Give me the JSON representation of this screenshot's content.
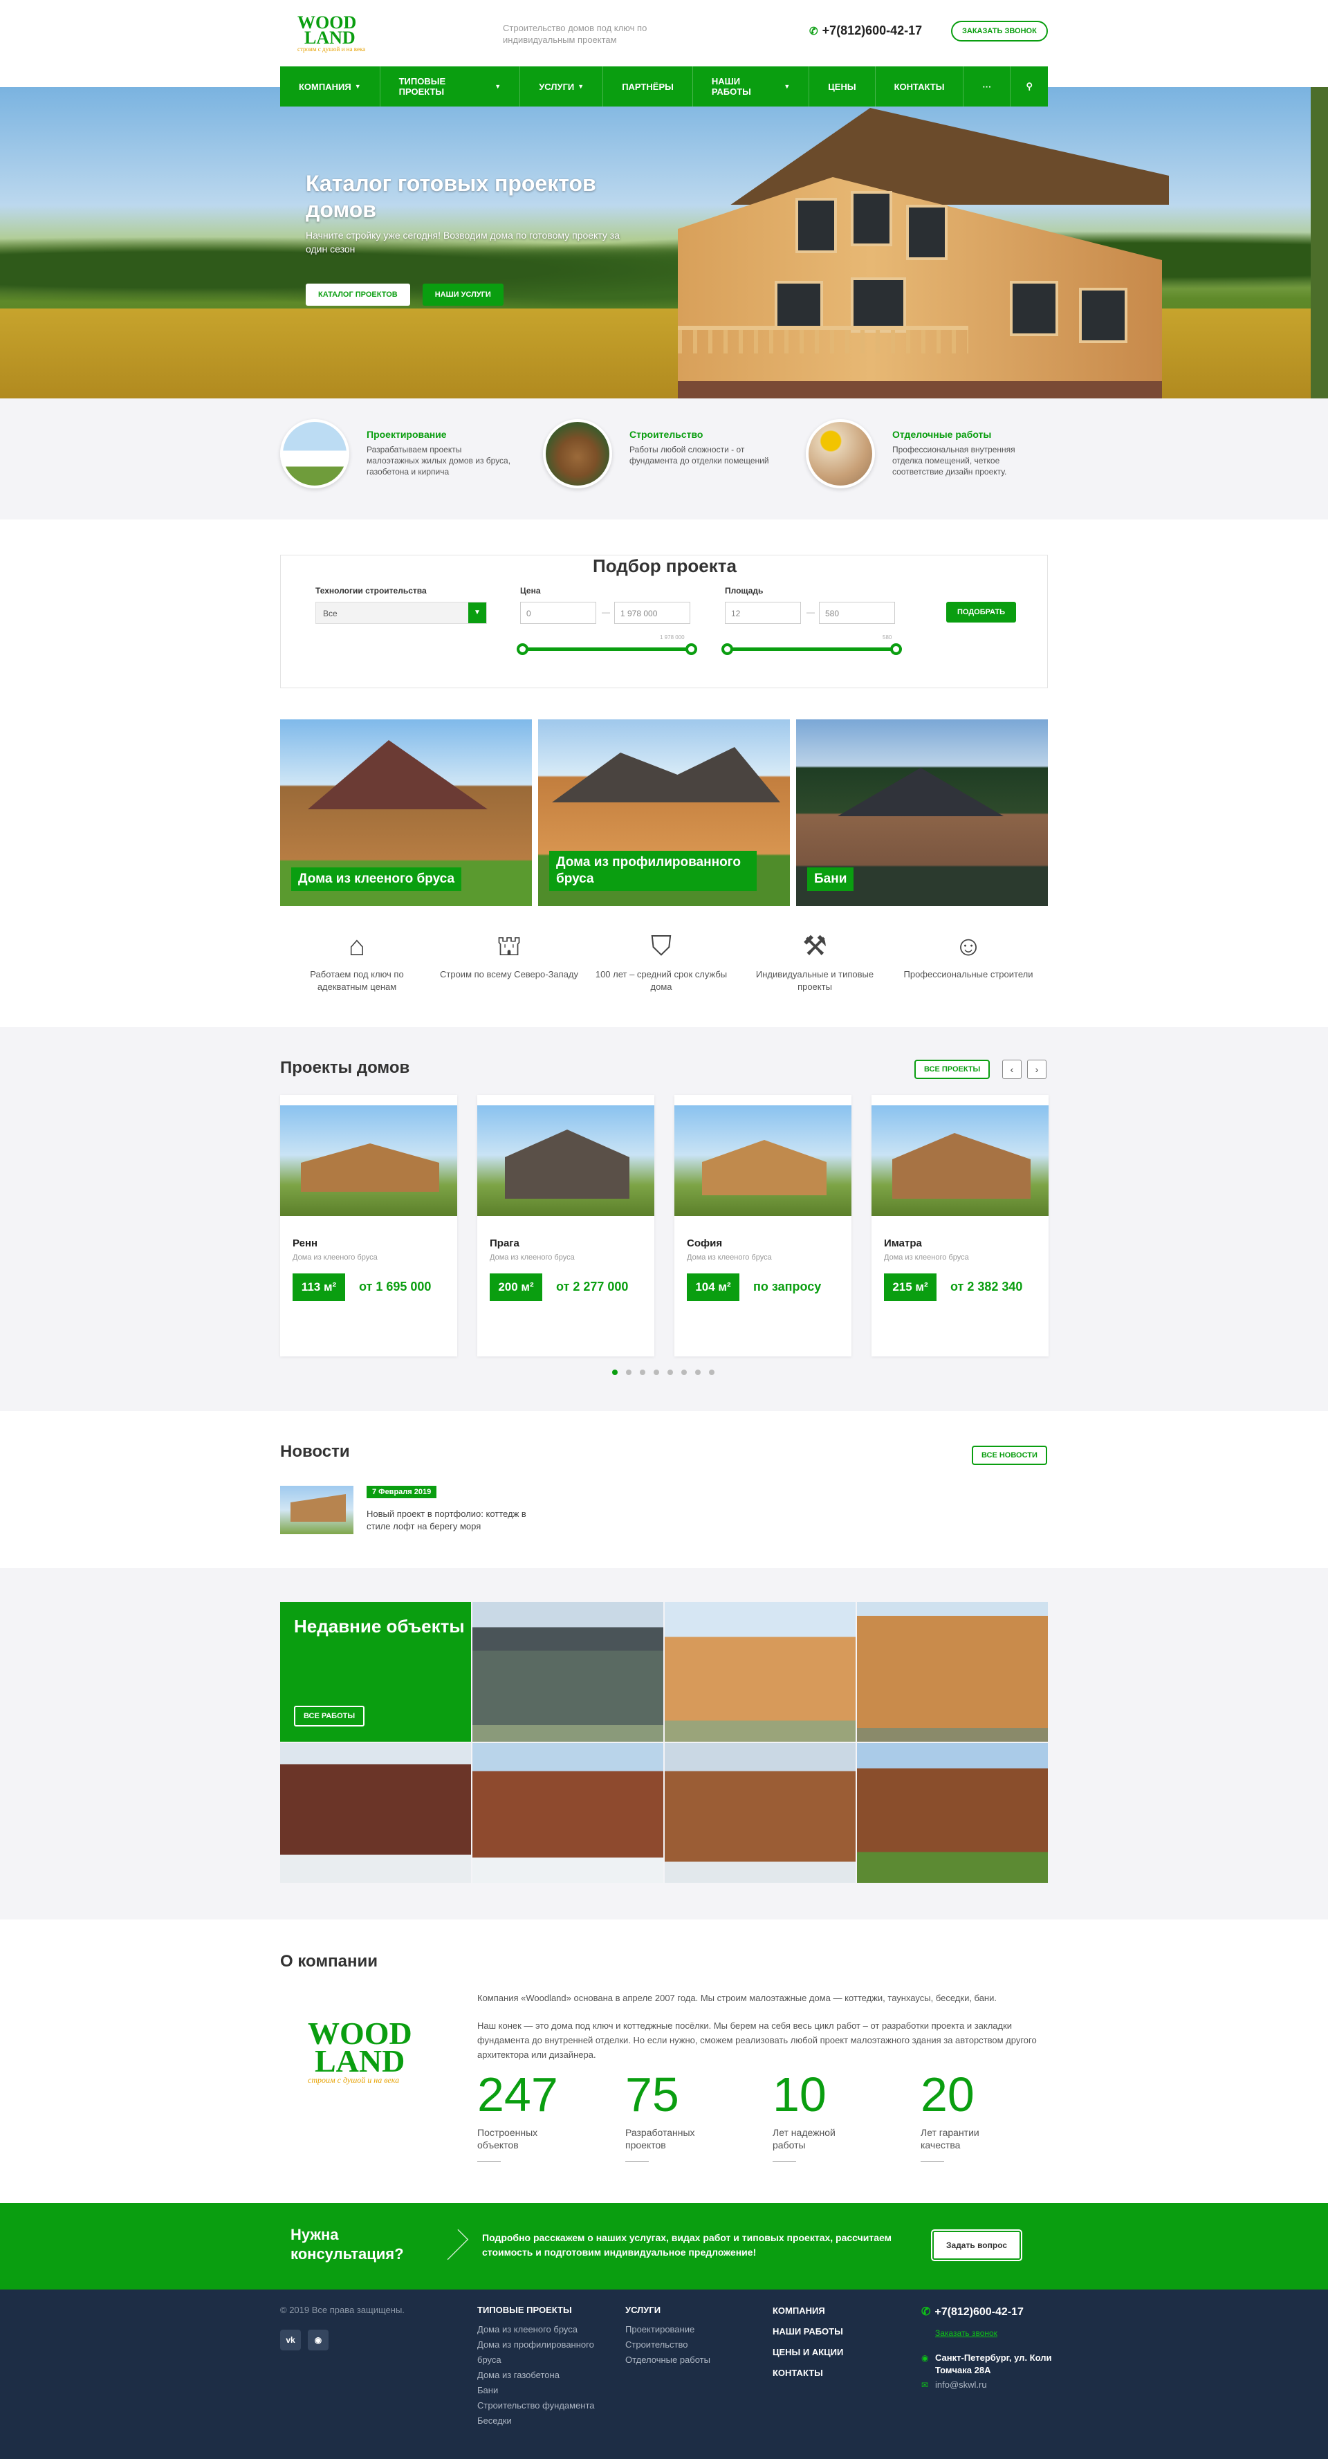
{
  "header": {
    "logo_top": "WOOD",
    "logo_bottom": "LAND",
    "logo_sub": "строим с душой и на века",
    "tagline": "Строительство домов под ключ по индивидуальным проектам",
    "phone": "+7(812)600-42-17",
    "call_button": "Заказать звонок"
  },
  "nav": {
    "items": [
      "Компания",
      "Типовые проекты",
      "Услуги",
      "Партнёры",
      "Наши работы",
      "Цены",
      "Контакты"
    ],
    "more": "···"
  },
  "hero": {
    "title": "Каталог готовых проектов домов",
    "subtitle": "Начните стройку уже сегодня! Возводим дома по готовому проекту за один сезон",
    "btn_catalog": "Каталог проектов",
    "btn_services": "Наши услуги"
  },
  "services": [
    {
      "title": "Проектирование",
      "text": "Разрабатываем проекты малоэтажных жилых домов из бруса, газобетона и кирпича"
    },
    {
      "title": "Строительство",
      "text": "Работы любой сложности - от фундамента до отделки помещений"
    },
    {
      "title": "Отделочные работы",
      "text": "Профессиональная внутренняя отделка помещений, четкое соответствие дизайн проекту."
    }
  ],
  "filter": {
    "title": "Подбор проекта",
    "tech_label": "Технологии строительства",
    "tech_value": "Все",
    "price_label": "Цена",
    "price_min": "0",
    "price_max": "1 978 000",
    "price_hint": "1 978 000",
    "area_label": "Площадь",
    "area_min": "12",
    "area_max": "580",
    "area_hint": "580",
    "submit": "Подобрать"
  },
  "categories": [
    {
      "label": "Дома из клееного бруса"
    },
    {
      "label": "Дома из профилированного бруса"
    },
    {
      "label": "Бани"
    }
  ],
  "features": [
    {
      "icon": "house-hand-icon",
      "text": "Работаем под ключ по адекватным ценам"
    },
    {
      "icon": "crane-icon",
      "text": "Строим по всему Северо-Западу"
    },
    {
      "icon": "shield-check-icon",
      "text": "100 лет – средний срок службы дома"
    },
    {
      "icon": "tools-icon",
      "text": "Индивидуальные и типовые проекты"
    },
    {
      "icon": "worker-icon",
      "text": "Профессиональные строители"
    }
  ],
  "projects": {
    "title": "Проекты домов",
    "all_button": "Все проекты",
    "items": [
      {
        "name": "Ренн",
        "type": "Дома из клееного бруса",
        "area": "113 м²",
        "price": "от 1 695 000"
      },
      {
        "name": "Прага",
        "type": "Дома из клееного бруса",
        "area": "200 м²",
        "price": "от 2 277 000"
      },
      {
        "name": "София",
        "type": "Дома из клееного бруса",
        "area": "104 м²",
        "price": "по запросу"
      },
      {
        "name": "Иматра",
        "type": "Дома из клееного бруса",
        "area": "215 м²",
        "price": "от 2 382 340"
      }
    ],
    "pages": 8,
    "active_page": 1
  },
  "news": {
    "title": "Новости",
    "all_button": "Все новости",
    "date": "7 Февраля 2019",
    "text": "Новый проект в портфолио: коттедж в стиле лофт на берегу моря"
  },
  "recent": {
    "title": "Недавние объекты",
    "button": "Все работы"
  },
  "about": {
    "title": "О компании",
    "p1": "Компания «Woodland» основана в апреле 2007 года. Мы строим малоэтажные дома — коттеджи, таунхаусы, беседки, бани.",
    "p2": "Наш конек — это дома под ключ и коттеджные посёлки. Мы берем на себя весь цикл работ – от разработки проекта и закладки фундамента до внутренней отделки. Но если нужно, сможем реализовать любой проект малоэтажного здания за авторством другого архитектора или дизайнера.",
    "stats": [
      {
        "num": "247",
        "text": "Построенных объектов"
      },
      {
        "num": "75",
        "text": "Разработанных проектов"
      },
      {
        "num": "10",
        "text": "Лет надежной работы"
      },
      {
        "num": "20",
        "text": "Лет гарантии качества"
      }
    ]
  },
  "consult": {
    "title": "Нужна консультация?",
    "text": "Подробно расскажем о наших услугах, видах работ и типовых проектах, рассчитаем стоимость и подготовим индивидуальное предложение!",
    "button": "Задать вопрос"
  },
  "footer": {
    "copyright": "© 2019 Все права защищены.",
    "vk": "vk",
    "col1_title": "Типовые проекты",
    "col1_links": [
      "Дома из клееного бруса",
      "Дома из профилированного бруса",
      "Дома из газобетона",
      "Бани",
      "Строительство фундамента",
      "Беседки"
    ],
    "col2_title": "Услуги",
    "col2_links": [
      "Проектирование",
      "Строительство",
      "Отделочные работы"
    ],
    "col3_links": [
      "Компания",
      "Наши работы",
      "Цены и акции",
      "Контакты"
    ],
    "phone": "+7(812)600-42-17",
    "call": "Заказать звонок",
    "address": "Санкт-Петербург, ул. Коли Томчака 28А",
    "email": "info@skwl.ru"
  },
  "colors": {
    "accent": "#0a9e10",
    "footer_bg": "#1d2d45",
    "section_bg": "#f4f4f7"
  }
}
